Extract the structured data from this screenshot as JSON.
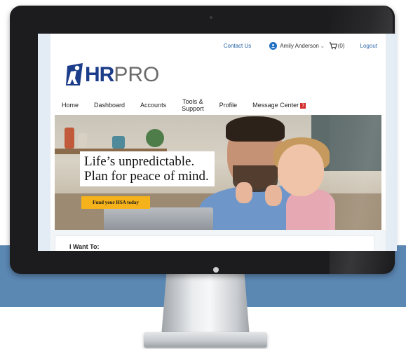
{
  "topbar": {
    "contact_label": "Contact Us",
    "user_name": "Amily Anderson",
    "cart_count": "(0)",
    "logout_label": "Logout"
  },
  "logo": {
    "hr_text": "HR",
    "pro_text": "PRO"
  },
  "nav": {
    "items": [
      {
        "label": "Home"
      },
      {
        "label": "Dashboard"
      },
      {
        "label": "Accounts"
      },
      {
        "label_line1": "Tools &",
        "label_line2": "Support"
      },
      {
        "label": "Profile"
      },
      {
        "label": "Message Center",
        "badge": "3"
      }
    ]
  },
  "hero": {
    "headline_line1": "Life’s unpredictable.",
    "headline_line2": "Plan for peace of mind.",
    "cta_label": "Fund your HSA today"
  },
  "panel": {
    "i_want_label": "I Want To:"
  },
  "colors": {
    "brand_blue": "#1c3d8a",
    "link_blue": "#1f5fa3",
    "cta_yellow": "#f5b21a",
    "band_blue": "#5b87b3",
    "badge_red": "#d32a2a"
  },
  "icons": [
    "user-avatar-icon",
    "chevron-down-icon",
    "cart-icon",
    "logo-person-mark"
  ]
}
